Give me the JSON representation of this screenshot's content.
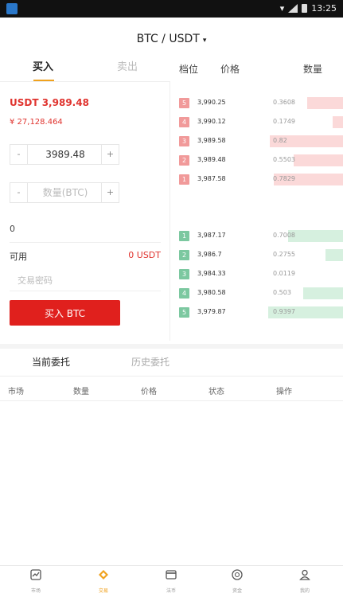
{
  "status_bar": {
    "time": "13:25"
  },
  "header": {
    "title": "BTC / USDT",
    "caret": "▾"
  },
  "trade_tabs": {
    "buy": "买入",
    "sell": "卖出"
  },
  "orderbook_header": {
    "level": "档位",
    "price": "价格",
    "quantity": "数量"
  },
  "balance": {
    "usdt": "USDT 3,989.48",
    "cny": "¥ 27,128.464"
  },
  "price_input": {
    "value": "3989.48",
    "minus": "-",
    "plus": "+"
  },
  "amount_input": {
    "placeholder": "数量(BTC)",
    "minus": "-",
    "plus": "+"
  },
  "total_value": "0",
  "available": {
    "label": "可用",
    "value": "0 USDT"
  },
  "password_input": {
    "placeholder": "交易密码"
  },
  "buy_button": "买入 BTC",
  "asks": [
    {
      "idx": "5",
      "price": "3,990.25",
      "qty": "0.3608",
      "depth": 0.4
    },
    {
      "idx": "4",
      "price": "3,990.12",
      "qty": "0.1749",
      "depth": 0.12
    },
    {
      "idx": "3",
      "price": "3,989.58",
      "qty": "0.82",
      "depth": 0.82
    },
    {
      "idx": "2",
      "price": "3,989.48",
      "qty": "0.5503",
      "depth": 0.55
    },
    {
      "idx": "1",
      "price": "3,987.58",
      "qty": "0.7829",
      "depth": 0.78
    }
  ],
  "bids": [
    {
      "idx": "1",
      "price": "3,987.17",
      "qty": "0.7008",
      "depth": 0.62
    },
    {
      "idx": "2",
      "price": "3,986.7",
      "qty": "0.2755",
      "depth": 0.2
    },
    {
      "idx": "3",
      "price": "3,984.33",
      "qty": "0.0119",
      "depth": 0.0
    },
    {
      "idx": "4",
      "price": "3,980.58",
      "qty": "0.503",
      "depth": 0.45
    },
    {
      "idx": "5",
      "price": "3,979.87",
      "qty": "0.9397",
      "depth": 0.84
    }
  ],
  "orders_tabs": {
    "current": "当前委托",
    "history": "历史委托"
  },
  "orders_columns": [
    "市场",
    "数量",
    "价格",
    "状态",
    "操作"
  ],
  "tabbar": [
    {
      "label": "市场",
      "icon": "chart-icon"
    },
    {
      "label": "交易",
      "icon": "exchange-icon",
      "active": true
    },
    {
      "label": "法币",
      "icon": "card-icon"
    },
    {
      "label": "资金",
      "icon": "coin-icon"
    },
    {
      "label": "我的",
      "icon": "person-icon"
    }
  ],
  "colors": {
    "accent": "#f0a21e",
    "red": "#e0342f",
    "green": "#7cc8a0"
  }
}
